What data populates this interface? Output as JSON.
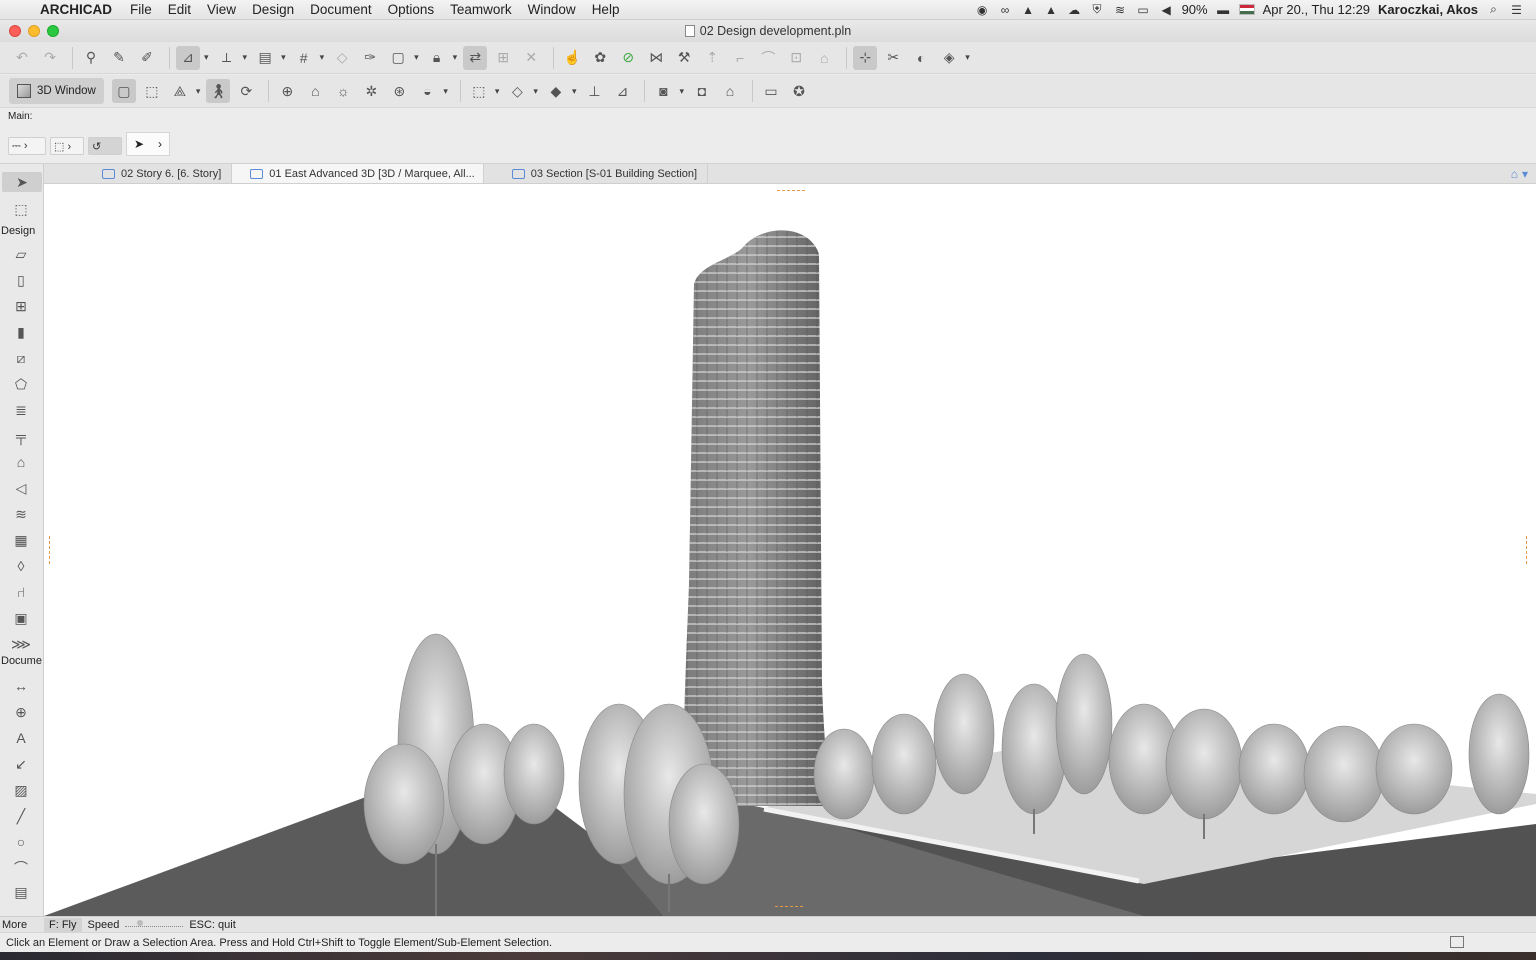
{
  "menubar": {
    "app_name": "ARCHICAD",
    "items": [
      "File",
      "Edit",
      "View",
      "Design",
      "Document",
      "Options",
      "Teamwork",
      "Window",
      "Help"
    ],
    "battery": "90%",
    "datetime": "Apr 20., Thu 12:29",
    "user": "Karoczkai, Akos"
  },
  "window": {
    "title": "02 Design development.pln"
  },
  "toolbar2": {
    "window_button_label": "3D Window"
  },
  "infobox": {
    "label": "Main:"
  },
  "tabs": [
    {
      "label": "02 Story 6. [6. Story]"
    },
    {
      "label": "01 East Advanced 3D [3D / Marquee, All..."
    },
    {
      "label": "03 Section [S-01 Building Section]"
    }
  ],
  "toolbox": {
    "group_design": "Design",
    "group_document": "Docume",
    "more": "More"
  },
  "navigation": {
    "fly": "F: Fly",
    "speed": "Speed",
    "quit": "ESC: quit"
  },
  "status": {
    "message": "Click an Element or Draw a Selection Area. Press and Hold Ctrl+Shift to Toggle Element/Sub-Element Selection."
  },
  "icons": {
    "apple": "apple-icon",
    "wifi": "wifi-icon",
    "search": "search-icon"
  }
}
